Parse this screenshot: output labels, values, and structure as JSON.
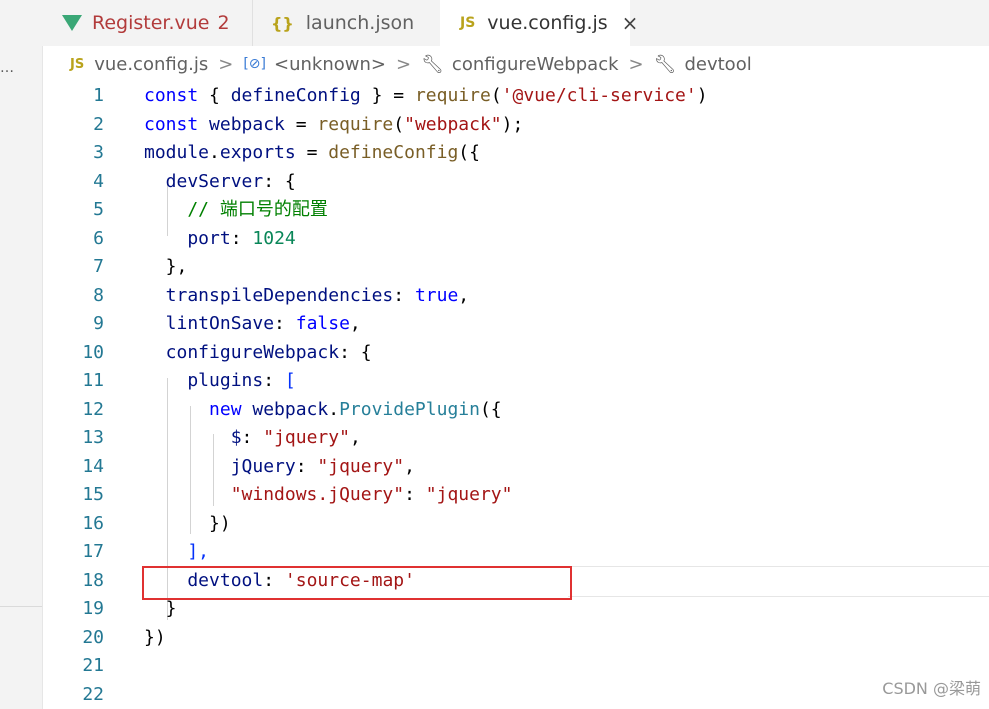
{
  "tabs": [
    {
      "label": "Register.vue",
      "badge": "2",
      "icon": "vue-icon"
    },
    {
      "label": "launch.json",
      "icon": "braces-icon",
      "icon_glyph": "{}"
    },
    {
      "label": "vue.config.js",
      "icon": "js-icon",
      "icon_glyph": "JS",
      "close": "×"
    }
  ],
  "breadcrumb": {
    "icon_glyph": "JS",
    "items": [
      "vue.config.js",
      "<unknown>",
      "configureWebpack",
      "devtool"
    ],
    "sep": ">"
  },
  "lines": [
    {
      "n": "1",
      "tokens": [
        [
          "const ",
          "#0000ff"
        ],
        [
          "{ ",
          "#000000"
        ],
        [
          "defineConfig",
          "#001080"
        ],
        [
          " } = ",
          "#000000"
        ],
        [
          "require",
          "#795e26"
        ],
        [
          "(",
          "#000000"
        ],
        [
          "'@vue/cli-service'",
          "#a31515"
        ],
        [
          ")",
          "#000000"
        ]
      ]
    },
    {
      "n": "2",
      "tokens": [
        [
          "const ",
          "#0000ff"
        ],
        [
          "webpack",
          "#001080"
        ],
        [
          " = ",
          "#000000"
        ],
        [
          "require",
          "#795e26"
        ],
        [
          "(",
          "#000000"
        ],
        [
          "\"webpack\"",
          "#a31515"
        ],
        [
          ");",
          "#000000"
        ]
      ]
    },
    {
      "n": "3",
      "tokens": [
        [
          "module",
          "#001080"
        ],
        [
          ".",
          "#000000"
        ],
        [
          "exports",
          "#001080"
        ],
        [
          " = ",
          "#000000"
        ],
        [
          "defineConfig",
          "#795e26"
        ],
        [
          "({",
          "#000000"
        ]
      ]
    },
    {
      "n": "4",
      "tokens": [
        [
          "  devServer",
          "#001080"
        ],
        [
          ": {",
          "#000000"
        ]
      ]
    },
    {
      "n": "5",
      "tokens": [
        [
          "    // 端口号的配置",
          "#008000"
        ]
      ]
    },
    {
      "n": "6",
      "tokens": [
        [
          "    port",
          "#001080"
        ],
        [
          ": ",
          "#000000"
        ],
        [
          "1024",
          "#098658"
        ]
      ]
    },
    {
      "n": "7",
      "tokens": [
        [
          "  },",
          "#000000"
        ]
      ]
    },
    {
      "n": "8",
      "tokens": [
        [
          "  transpileDependencies",
          "#001080"
        ],
        [
          ": ",
          "#000000"
        ],
        [
          "true",
          "#0000ff"
        ],
        [
          ",",
          "#000000"
        ]
      ]
    },
    {
      "n": "9",
      "tokens": [
        [
          "  lintOnSave",
          "#001080"
        ],
        [
          ": ",
          "#000000"
        ],
        [
          "false",
          "#0000ff"
        ],
        [
          ",",
          "#000000"
        ]
      ]
    },
    {
      "n": "10",
      "tokens": [
        [
          "  configureWebpack",
          "#001080"
        ],
        [
          ": ",
          "#000000"
        ],
        [
          "{",
          "#000000"
        ]
      ]
    },
    {
      "n": "11",
      "tokens": [
        [
          "    plugins",
          "#001080"
        ],
        [
          ": ",
          "#000000"
        ],
        [
          "[",
          "#0431fa"
        ]
      ]
    },
    {
      "n": "12",
      "tokens": [
        [
          "      new ",
          "#0000ff"
        ],
        [
          "webpack",
          "#001080"
        ],
        [
          ".",
          "#000000"
        ],
        [
          "ProvidePlugin",
          "#267f99"
        ],
        [
          "({",
          "#000000"
        ]
      ]
    },
    {
      "n": "13",
      "tokens": [
        [
          "        $",
          "#001080"
        ],
        [
          ": ",
          "#000000"
        ],
        [
          "\"jquery\"",
          "#a31515"
        ],
        [
          ",",
          "#000000"
        ]
      ]
    },
    {
      "n": "14",
      "tokens": [
        [
          "        jQuery",
          "#001080"
        ],
        [
          ": ",
          "#000000"
        ],
        [
          "\"jquery\"",
          "#a31515"
        ],
        [
          ",",
          "#000000"
        ]
      ]
    },
    {
      "n": "15",
      "tokens": [
        [
          "        \"windows.jQuery\"",
          "#a31515"
        ],
        [
          ": ",
          "#000000"
        ],
        [
          "\"jquery\"",
          "#a31515"
        ]
      ]
    },
    {
      "n": "16",
      "tokens": [
        [
          "      })",
          "#000000"
        ]
      ]
    },
    {
      "n": "17",
      "tokens": [
        [
          "    ],",
          "#0431fa"
        ]
      ]
    },
    {
      "n": "18",
      "tokens": [
        [
          "    devtool",
          "#001080"
        ],
        [
          ": ",
          "#000000"
        ],
        [
          "'source-map'",
          "#a31515"
        ]
      ]
    },
    {
      "n": "19",
      "tokens": [
        [
          "  }",
          "#000000"
        ]
      ]
    },
    {
      "n": "20",
      "tokens": [
        [
          "})",
          "#000000"
        ]
      ]
    },
    {
      "n": "21",
      "tokens": []
    },
    {
      "n": "22",
      "tokens": []
    }
  ],
  "watermark": "CSDN @梁萌",
  "colors": {
    "highlight_box": "#e03131",
    "line_number": "#237893"
  }
}
